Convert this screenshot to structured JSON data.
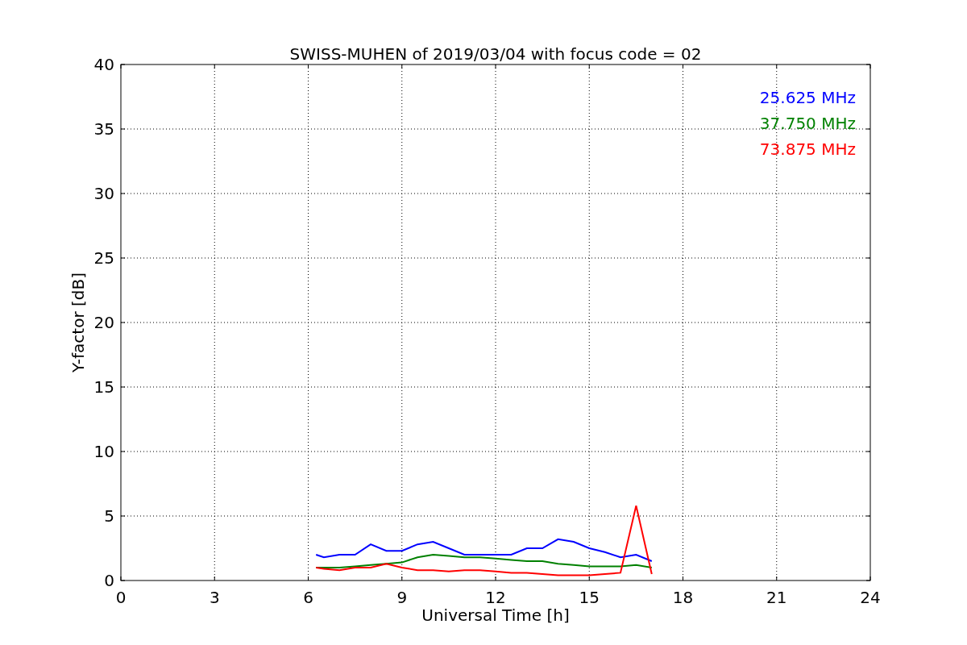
{
  "chart_data": {
    "type": "line",
    "title": "SWISS-MUHEN of 2019/03/04 with focus code = 02",
    "xlabel": "Universal Time [h]",
    "ylabel": "Y-factor [dB]",
    "x": [
      6.25,
      6.5,
      7,
      7.5,
      8,
      8.5,
      9,
      9.5,
      10,
      10.5,
      11,
      11.5,
      12,
      12.5,
      13,
      13.5,
      14,
      14.5,
      15,
      15.5,
      16,
      16.5,
      17
    ],
    "series": [
      {
        "name": "25.625 MHz",
        "color": "#0000ff",
        "values": [
          2,
          1.8,
          2,
          2,
          2.8,
          2.3,
          2.3,
          2.8,
          3,
          2.5,
          2,
          2,
          2,
          2,
          2.5,
          2.5,
          3.2,
          3,
          2.5,
          2.2,
          1.8,
          2,
          1.5
        ]
      },
      {
        "name": "37.750 MHz",
        "color": "#008000",
        "values": [
          1,
          1,
          1,
          1.1,
          1.2,
          1.3,
          1.4,
          1.8,
          2,
          1.9,
          1.8,
          1.8,
          1.7,
          1.6,
          1.5,
          1.5,
          1.3,
          1.2,
          1.1,
          1.1,
          1.1,
          1.2,
          1
        ]
      },
      {
        "name": "73.875 MHz",
        "color": "#ff0000",
        "values": [
          1,
          0.9,
          0.8,
          1,
          1,
          1.3,
          1,
          0.8,
          0.8,
          0.7,
          0.8,
          0.8,
          0.7,
          0.6,
          0.6,
          0.5,
          0.4,
          0.4,
          0.4,
          0.5,
          0.6,
          5.8,
          0.5
        ]
      }
    ],
    "grid": true,
    "xlim": [
      0,
      24
    ],
    "ylim": [
      0,
      40
    ],
    "xticks": [
      0,
      3,
      6,
      9,
      12,
      15,
      18,
      21,
      24
    ],
    "yticks": [
      0,
      5,
      10,
      15,
      20,
      25,
      30,
      35,
      40
    ]
  }
}
